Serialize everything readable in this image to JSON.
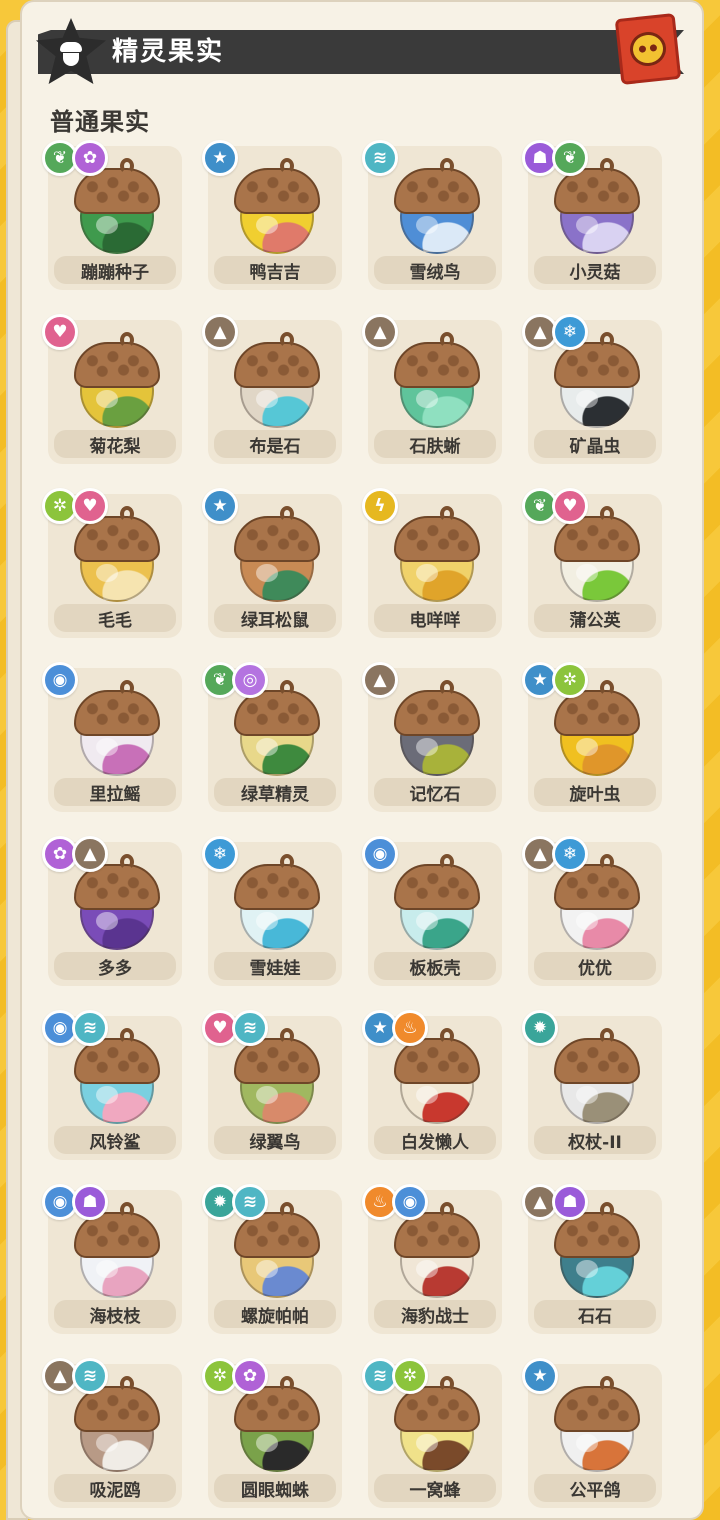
{
  "header": {
    "title": "精灵果实",
    "close_icon": "bear-badge-icon"
  },
  "section": {
    "title": "普通果实"
  },
  "type_styles": {
    "grass": {
      "color": "#55a85a",
      "glyph": "❦"
    },
    "fairy": {
      "color": "#b062d6",
      "glyph": "✿"
    },
    "normal": {
      "color": "#3f8fc9",
      "glyph": "★"
    },
    "wind": {
      "color": "#4fb6c4",
      "glyph": "≋"
    },
    "ghost": {
      "color": "#9a5bd9",
      "glyph": "☗"
    },
    "heart": {
      "color": "#e0628f",
      "glyph": "♥"
    },
    "rock": {
      "color": "#8a7560",
      "glyph": "▲"
    },
    "ice": {
      "color": "#3d9ad6",
      "glyph": "❄"
    },
    "bug": {
      "color": "#8cc43c",
      "glyph": "✲"
    },
    "electric": {
      "color": "#e6b820",
      "glyph": "ϟ"
    },
    "water": {
      "color": "#4c8fd8",
      "glyph": "◉"
    },
    "spiral": {
      "color": "#b473e0",
      "glyph": "◎"
    },
    "fire": {
      "color": "#f08a2c",
      "glyph": "♨"
    },
    "mech": {
      "color": "#3aa59a",
      "glyph": "✹"
    }
  },
  "fruits": [
    {
      "name": "蹦蹦种子",
      "types": [
        "grass",
        "fairy"
      ],
      "body_color": "#3f9a4d",
      "accent_color": "#2a6a34"
    },
    {
      "name": "鸭吉吉",
      "types": [
        "normal"
      ],
      "body_color": "#f0cf30",
      "accent_color": "#e07a6a"
    },
    {
      "name": "雪绒鸟",
      "types": [
        "wind"
      ],
      "body_color": "#4f8ed6",
      "accent_color": "#dbe9f7"
    },
    {
      "name": "小灵菇",
      "types": [
        "ghost",
        "grass"
      ],
      "body_color": "#8a72c9",
      "accent_color": "#d9d2f2"
    },
    {
      "name": "菊花梨",
      "types": [
        "heart"
      ],
      "body_color": "#e4c43a",
      "accent_color": "#6aa040"
    },
    {
      "name": "布是石",
      "types": [
        "rock"
      ],
      "body_color": "#e0d6c6",
      "accent_color": "#56c7d6"
    },
    {
      "name": "石肤蜥",
      "types": [
        "rock"
      ],
      "body_color": "#5fc49b",
      "accent_color": "#8fe0c0"
    },
    {
      "name": "矿晶虫",
      "types": [
        "rock",
        "ice"
      ],
      "body_color": "#e8ecec",
      "accent_color": "#2b2f33"
    },
    {
      "name": "毛毛",
      "types": [
        "bug",
        "heart"
      ],
      "body_color": "#ecc14e",
      "accent_color": "#f6e4b0"
    },
    {
      "name": "绿耳松鼠",
      "types": [
        "normal"
      ],
      "body_color": "#c88a54",
      "accent_color": "#3f8a5a"
    },
    {
      "name": "电咩咩",
      "types": [
        "electric"
      ],
      "body_color": "#f0d26a",
      "accent_color": "#e0a42a"
    },
    {
      "name": "蒲公英",
      "types": [
        "grass",
        "heart"
      ],
      "body_color": "#f2efe2",
      "accent_color": "#7ac83a"
    },
    {
      "name": "里拉鳐",
      "types": [
        "water"
      ],
      "body_color": "#f0eaf0",
      "accent_color": "#c870b8"
    },
    {
      "name": "绿草精灵",
      "types": [
        "grass",
        "spiral"
      ],
      "body_color": "#e8d88a",
      "accent_color": "#3e8a3e"
    },
    {
      "name": "记忆石",
      "types": [
        "rock"
      ],
      "body_color": "#6b6c78",
      "accent_color": "#a8b23a"
    },
    {
      "name": "旋叶虫",
      "types": [
        "normal",
        "bug"
      ],
      "body_color": "#f0c020",
      "accent_color": "#e0962a"
    },
    {
      "name": "多多",
      "types": [
        "fairy",
        "rock"
      ],
      "body_color": "#7a4cb8",
      "accent_color": "#5a3490"
    },
    {
      "name": "雪娃娃",
      "types": [
        "ice"
      ],
      "body_color": "#e0f2f4",
      "accent_color": "#48b8d8"
    },
    {
      "name": "板板壳",
      "types": [
        "water"
      ],
      "body_color": "#c8ecec",
      "accent_color": "#3aa58a"
    },
    {
      "name": "优优",
      "types": [
        "rock",
        "ice"
      ],
      "body_color": "#f2f2f2",
      "accent_color": "#e88aa8"
    },
    {
      "name": "风铃鲨",
      "types": [
        "water",
        "wind"
      ],
      "body_color": "#7ad0e0",
      "accent_color": "#f0a8c0"
    },
    {
      "name": "绿翼鸟",
      "types": [
        "heart",
        "wind"
      ],
      "body_color": "#a0b860",
      "accent_color": "#d88a6a"
    },
    {
      "name": "白发懒人",
      "types": [
        "normal",
        "fire"
      ],
      "body_color": "#f0e6d2",
      "accent_color": "#c8382e"
    },
    {
      "name": "权杖-II",
      "types": [
        "mech"
      ],
      "body_color": "#e8e8e8",
      "accent_color": "#9a9078"
    },
    {
      "name": "海枝枝",
      "types": [
        "water",
        "ghost"
      ],
      "body_color": "#f0f2f6",
      "accent_color": "#e8a4c0"
    },
    {
      "name": "螺旋帕帕",
      "types": [
        "mech",
        "wind"
      ],
      "body_color": "#e8c878",
      "accent_color": "#6a8ad0"
    },
    {
      "name": "海豹战士",
      "types": [
        "fire",
        "water"
      ],
      "body_color": "#f0e6d6",
      "accent_color": "#b83a32"
    },
    {
      "name": "石石",
      "types": [
        "rock",
        "ghost"
      ],
      "body_color": "#3e7f8c",
      "accent_color": "#64d0d8"
    },
    {
      "name": "吸泥鸥",
      "types": [
        "rock",
        "wind"
      ],
      "body_color": "#b89a86",
      "accent_color": "#f0ece6"
    },
    {
      "name": "圆眼蜘蛛",
      "types": [
        "bug",
        "fairy"
      ],
      "body_color": "#7aa24a",
      "accent_color": "#2a2a2a"
    },
    {
      "name": "一窝蜂",
      "types": [
        "wind",
        "bug"
      ],
      "body_color": "#f0e28a",
      "accent_color": "#7a4a2a"
    },
    {
      "name": "公平鸽",
      "types": [
        "normal"
      ],
      "body_color": "#f0f0f0",
      "accent_color": "#d8743a"
    }
  ]
}
